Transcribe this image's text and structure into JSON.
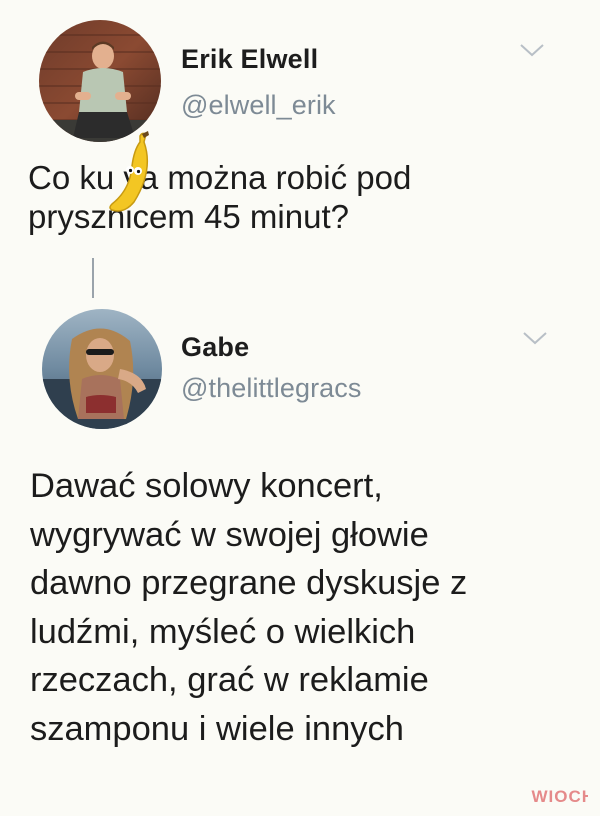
{
  "tweet1": {
    "display_name": "Erik Elwell",
    "handle": "@elwell_erik",
    "text": "Co ku  va można robić pod\nprysznicem 45 minut?",
    "avatar_icon": "profile-photo-man",
    "menu_icon": "chevron-down-icon"
  },
  "tweet2": {
    "display_name": "Gabe",
    "handle": "@thelittlegracs",
    "text": "Dawać solowy koncert,\nwygrywać w swojej głowie\ndawno przegrane dyskusje z\nludźmi, myśleć o wielkich\nrzeczach, grać w reklamie\nszamponu i wiele innych",
    "avatar_icon": "profile-photo-woman",
    "menu_icon": "chevron-down-icon"
  },
  "sticker": {
    "icon": "banana-emoji-sticker"
  },
  "watermark": {
    "text": "WIOCHA",
    "logo_icon": "wiocha-logo-icon"
  },
  "colors": {
    "background": "#fbfbf6",
    "name": "#1d1d1d",
    "handle": "#7d8a95",
    "text": "#1c1c1c",
    "thread_line": "#9aa3ab",
    "banana": "#f3c623"
  }
}
